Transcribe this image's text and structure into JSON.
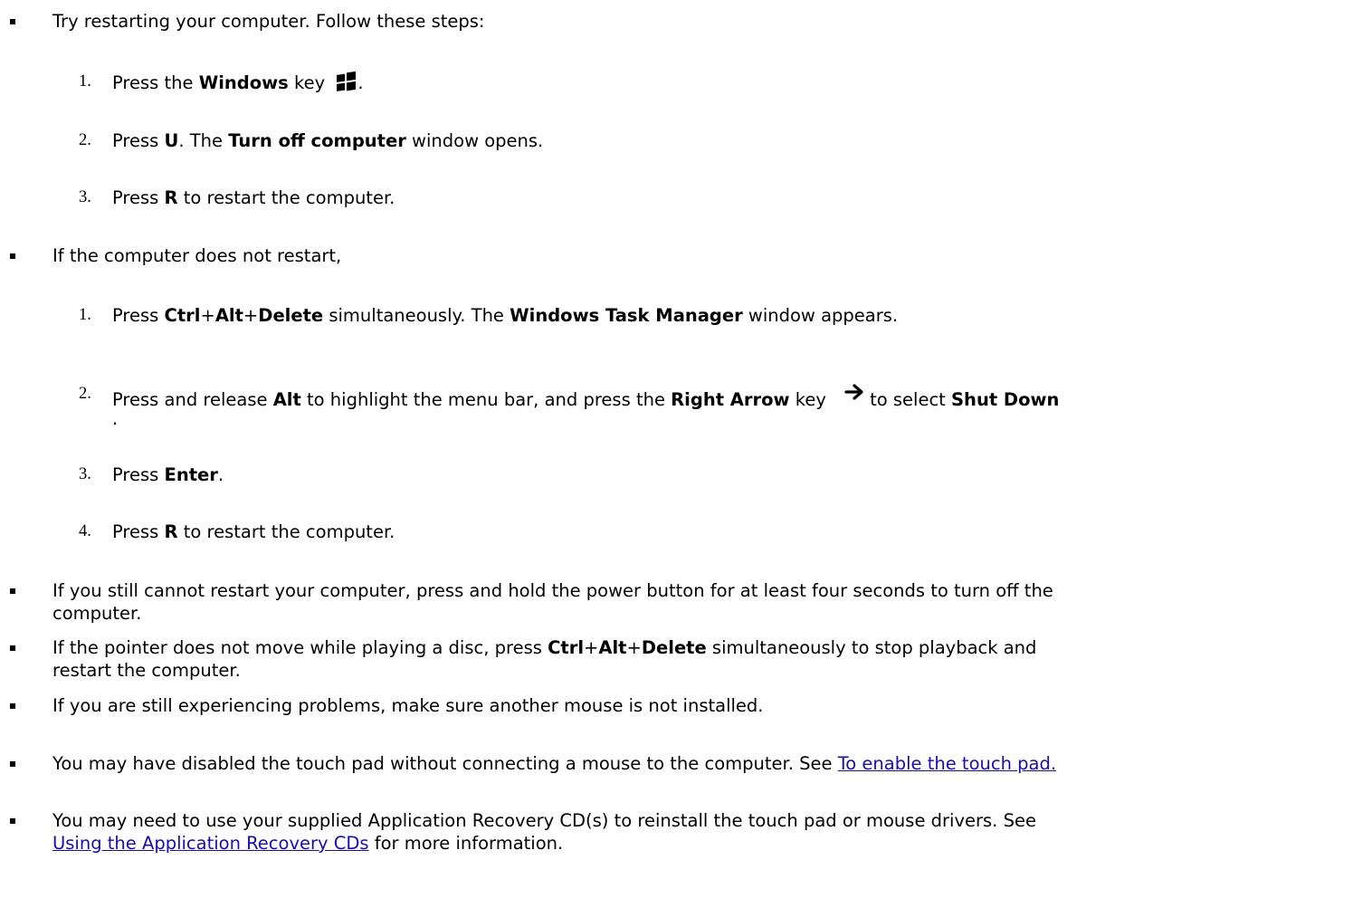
{
  "items": {
    "b1": "Try restarting your computer. Follow these steps:",
    "s1": {
      "n1": "1.",
      "n2": "2.",
      "n3": "3.",
      "press": "Press",
      "the": " the ",
      "windows": "Windows",
      "key": " key",
      "period": ".",
      "u": "U",
      "u_after": ". The ",
      "turn_off": "Turn off computer",
      "window_opens": " window opens.",
      "r": "R",
      "restart": " to restart the computer."
    },
    "b2": "If the computer does not restart,",
    "s2": {
      "n1": "1.",
      "n2": "2.",
      "n3": "3.",
      "n4": "4.",
      "press": "Press",
      "ctrl": "Ctrl",
      "plus": "+",
      "alt": "Alt",
      "delete": "Delete",
      "simult": " simultaneously. The ",
      "task_manager": "Windows Task Manager",
      "appears": " window appears.",
      "press_release": "Press and release ",
      "highlight": " to highlight the menu bar, and press the ",
      "right_arrow": "Right Arrow",
      "key": " key",
      "to_select": "to select ",
      "shut_down": "Shut Down",
      "dot": ".",
      "enter": "Enter",
      "r": "R",
      "restart": " to restart the computer."
    },
    "b3_l1": "If you still cannot restart your computer, press and hold the power button for at least four seconds to turn off the",
    "b3_l2": "computer.",
    "b4_pre": "If the pointer does not move while playing a disc, press ",
    "b4_post": " simultaneously to stop playback and",
    "b4_l2": "restart the computer.",
    "b5": "If you are still experiencing problems, make sure another mouse is not installed.",
    "b6_pre": "You may have disabled the touch pad without connecting a mouse to the computer. See ",
    "b6_link": "To enable the touch pad.",
    "b7_l1": "You may need to use your supplied Application Recovery CD(s) to reinstall the touch pad or mouse drivers. See",
    "b7_link": "Using the Application Recovery CDs",
    "b7_post": " for more information."
  }
}
